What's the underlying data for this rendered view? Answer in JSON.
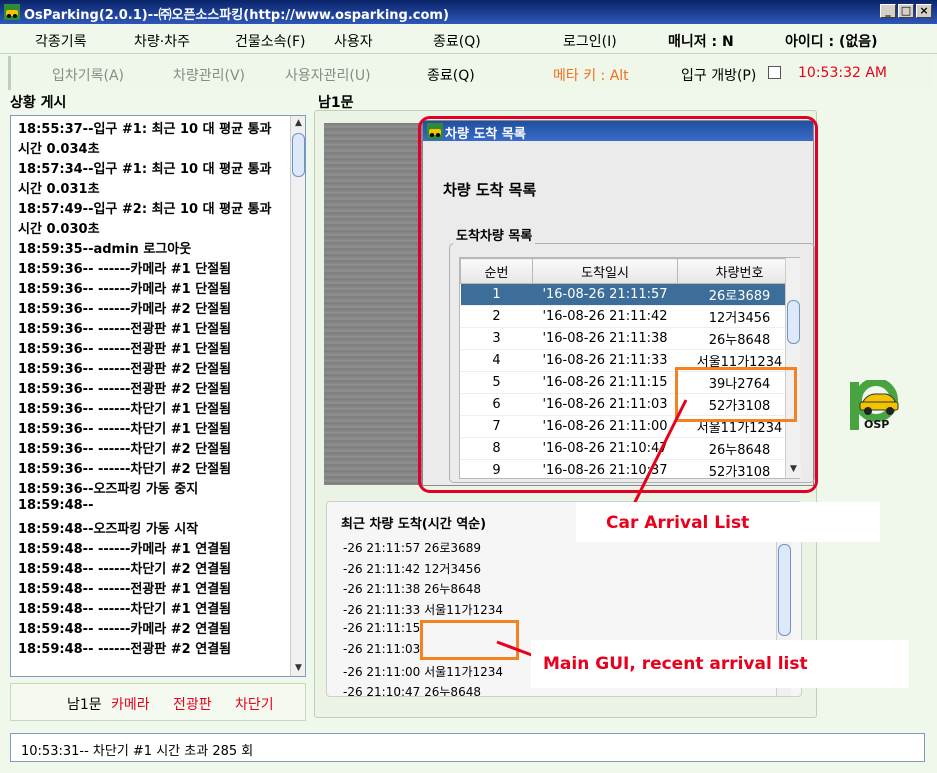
{
  "window": {
    "title": "OsParking(2.0.1)--㈜오픈소스파킹(http://www.osparking.com)",
    "buttons": [
      "_",
      "□",
      "×"
    ]
  },
  "menubar": {
    "items": [
      "각종기록",
      "차량·차주",
      "건물소속(F)",
      "사용자",
      "종료(Q)",
      "로그인(I)",
      "매니저 : N",
      "아이디 : (없음)"
    ]
  },
  "toolbar": {
    "entry_records": "입차기록(A)",
    "vehicle_mgmt": "차량관리(V)",
    "user_mgmt": "사용자관리(U)",
    "quit": "종료(Q)",
    "meta_key": "메타 키 : Alt",
    "entry_open": "입구 개방(P)",
    "entry_open_checked": false,
    "clock": "10:53:32 AM",
    "clock_color": "#e8001c",
    "meta_color": "#f07020"
  },
  "log_panel": {
    "title": "상황 게시",
    "lines": [
      "18:55:37--입구 #1: 최근 10 대 평균 통과",
      "시간 0.034초",
      "18:57:34--입구 #1: 최근 10 대 평균 통과",
      "시간 0.031초",
      "18:57:49--입구 #2: 최근 10 대 평균 통과",
      "시간 0.030초",
      "18:59:35--admin 로그아웃",
      "18:59:36--  ------카메라 #1 단절됨",
      "18:59:36--  ------카메라 #1 단절됨",
      "18:59:36--  ------카메라 #2 단절됨",
      "18:59:36--  ------전광판 #1 단절됨",
      "18:59:36--  ------전광판 #1 단절됨",
      "18:59:36--  ------전광판 #2 단절됨",
      "18:59:36--  ------전광판 #2 단절됨",
      "18:59:36--  ------차단기 #1 단절됨",
      "18:59:36--  ------차단기 #1 단절됨",
      "18:59:36--  ------차단기 #2 단절됨",
      "18:59:36--  ------차단기 #2 단절됨",
      "18:59:36--오즈파킹 가동 중지",
      "18:59:48--",
      "18:59:48--오즈파킹 가동 시작",
      "18:59:48--  ------카메라 #1 연결됨",
      "18:59:48--  ------차단기 #2 연결됨",
      "18:59:48--  ------전광판 #1 연결됨",
      "18:59:48--  ------차단기 #1 연결됨",
      "18:59:48--  ------카메라 #2 연결됨",
      "18:59:48--  ------전광판 #2 연결됨"
    ]
  },
  "device_status": {
    "gate": "남1문",
    "camera": "카메라",
    "display": "전광판",
    "barrier": "차단기",
    "alert_color": "#e8001c"
  },
  "gate_panel": {
    "title": "남1문"
  },
  "dialog": {
    "title": "차량 도착 목록",
    "heading": "차량 도착 목록",
    "group_label": "도착차량 목록",
    "columns": [
      "순번",
      "도착일시",
      "차량번호"
    ],
    "rows": [
      [
        "1",
        "'16-08-26 21:11:57",
        "26로3689"
      ],
      [
        "2",
        "'16-08-26 21:11:42",
        "12거3456"
      ],
      [
        "3",
        "'16-08-26 21:11:38",
        "26누8648"
      ],
      [
        "4",
        "'16-08-26 21:11:33",
        "서울11가1234"
      ],
      [
        "5",
        "'16-08-26 21:11:15",
        "39나2764"
      ],
      [
        "6",
        "'16-08-26 21:11:03",
        "52가3108"
      ],
      [
        "7",
        "'16-08-26 21:11:00",
        "서울11가1234"
      ],
      [
        "8",
        "'16-08-26 21:10:47",
        "26누8648"
      ],
      [
        "9",
        "'16-08-26 21:10:37",
        "52가3108"
      ]
    ],
    "selected_row": 1
  },
  "recent_panel": {
    "title": "최근 차량 도착(시간 역순)",
    "lines": [
      "-26 21:11:57 26로3689",
      "-26 21:11:42 12거3456",
      "-26 21:11:38 26누8648",
      "-26 21:11:33 서울11가1234",
      "-26 21:11:15",
      "-26 21:11:03",
      "-26 21:11:00 서울11가1234",
      "-26 21:10:47 26누8648"
    ]
  },
  "annotations": {
    "car_arrival_list": "Car Arrival List",
    "main_gui_recent": "Main GUI, recent arrival list",
    "color": "#e8001c",
    "box_color": "#f58220"
  },
  "logo": {
    "text": "OSP"
  },
  "statusbar": {
    "text": "10:53:31-- 차단기 #1 시간 초과 285 회"
  }
}
